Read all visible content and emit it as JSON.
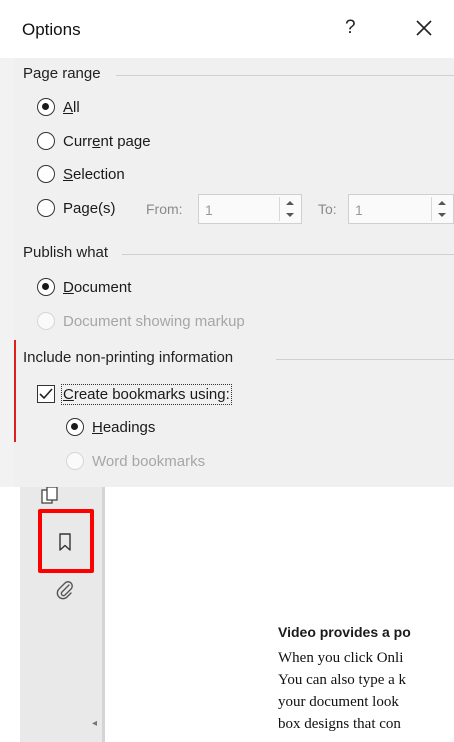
{
  "dialog": {
    "title": "Options",
    "help_label": "?",
    "page_range": {
      "label": "Page range",
      "options": {
        "all": {
          "pre": "",
          "key": "A",
          "post": "ll"
        },
        "current": {
          "pre": "Curr",
          "key": "e",
          "post": "nt page"
        },
        "selection": {
          "pre": "",
          "key": "S",
          "post": "election"
        },
        "pages": {
          "pre": "Pa",
          "key": "g",
          "post": "e(s)"
        }
      },
      "selected": "All",
      "from_label": "From:",
      "from_value": "1",
      "to_label": "To:",
      "to_value": "1"
    },
    "publish_what": {
      "label": "Publish what",
      "document": {
        "pre": "",
        "key": "D",
        "post": "ocument"
      },
      "markup": "Document showing markup",
      "selected": "Document"
    },
    "non_printing": {
      "label": "Include non-printing information",
      "create_bookmarks": {
        "pre": "",
        "key": "C",
        "post": "reate bookmarks using:"
      },
      "create_bookmarks_checked": true,
      "headings": {
        "pre": "",
        "key": "H",
        "post": "eadings"
      },
      "word_bookmarks": "Word bookmarks",
      "selected": "Headings"
    }
  },
  "document": {
    "heading": "Video provides a po",
    "lines": [
      "When you click Onli",
      "You can also type a k",
      "your document look",
      "box designs that con"
    ]
  },
  "side_panel": {
    "icons": [
      "page-thumbnails-icon",
      "bookmark-icon",
      "attachment-icon"
    ],
    "collapse_arrow": "◂"
  },
  "colors": {
    "highlight": "#ff0000",
    "accent_bar": "#e01e1e",
    "dialog_bg": "#f0f0f0"
  }
}
